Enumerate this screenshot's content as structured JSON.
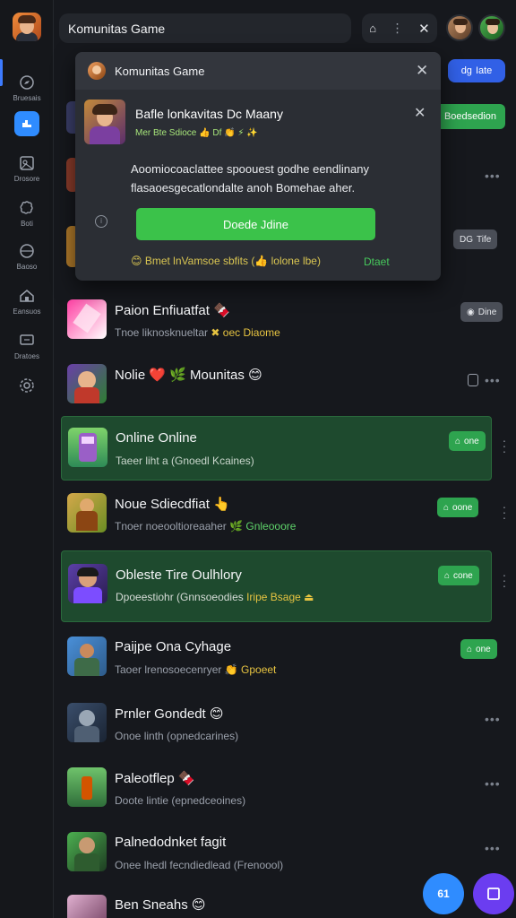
{
  "app": {
    "title": "Komunitas Game"
  },
  "sidebar": {
    "items": [
      {
        "label": "Bruesais",
        "icon": "compass-icon"
      },
      {
        "label": "Drosore",
        "icon": "gamepad-icon"
      },
      {
        "label": "Boti",
        "icon": "puzzle-icon"
      },
      {
        "label": "Baoso",
        "icon": "globe-icon"
      },
      {
        "label": "Eansuos",
        "icon": "home-icon"
      },
      {
        "label": "Dratoes",
        "icon": "monitor-icon"
      }
    ]
  },
  "topbar": {
    "search_value": "Komunitas Game",
    "home_icon": "home-icon",
    "more_icon": "more-vertical-icon",
    "close_icon": "close-icon"
  },
  "header_buttons": {
    "blue_label": "Iate",
    "blue_icon": "dg",
    "green_label": "Boedsedion"
  },
  "popup": {
    "title": "Komunitas Game",
    "card_title": "Bafle lonkavitas Dc Maany",
    "card_meta": "Mer Bte Sdioce 👍 Df 👏 ⚡ ✨",
    "description": "Aoomiocoaclattee spoouest godhe eendlinany flasaoesgecatlondalte anoh Bomehae aher.",
    "button_label": "Doede Jdine",
    "footer_text": "😊 Bmet lnVamsoe sbfits (👍 lolone lbe)",
    "footer_link": "Dtaet"
  },
  "rows": [
    {
      "title": "Paion Enfiuatfat 🍫",
      "subtitle_a": "Tnoe liknosknueltar ",
      "subtitle_b": "✖ oec Diaome",
      "badge": "Dine",
      "badge_icon": "◉",
      "badge_style": "gray"
    },
    {
      "title": "Nolie ❤️ 🌿 Mounitas 😊",
      "subtitle_a": "",
      "subtitle_b": "",
      "badge": "",
      "badge_icon": "",
      "badge_style": "none"
    },
    {
      "title": "Online Online",
      "subtitle_a": "Taeer liht a (Gnoedl Kcaines)",
      "subtitle_b": "",
      "badge": "one",
      "badge_icon": "⌂",
      "badge_style": "green"
    },
    {
      "title": "Noue Sdiecdfiat 👆",
      "subtitle_a": "Tnoer noeooltioreaaher ",
      "subtitle_b": "🌿 Gnleooore",
      "badge": "oone",
      "badge_icon": "⌂",
      "badge_style": "green"
    },
    {
      "title": "Obleste Tire Oulhlory",
      "subtitle_a": "Dpoeestiohr (Gnnsoeodies ",
      "subtitle_b": "Iripe Bsage ⏏",
      "badge": "cone",
      "badge_icon": "⌂",
      "badge_style": "green"
    },
    {
      "title": "Paijpe Ona Cyhage",
      "subtitle_a": "Taoer lrenosoecenryer ",
      "subtitle_b": "👏 Gpoeet",
      "badge": "one",
      "badge_icon": "⌂",
      "badge_style": "green"
    },
    {
      "title": "Prnler Gondedt 😊",
      "subtitle_a": "Onoe linth (opnedcarines)",
      "subtitle_b": "",
      "badge": "",
      "badge_icon": "",
      "badge_style": "none"
    },
    {
      "title": "Paleotflep 🍫",
      "subtitle_a": "Doote lintie (epnedceoines)",
      "subtitle_b": "",
      "badge": "",
      "badge_icon": "",
      "badge_style": "none"
    },
    {
      "title": "Palnedodnket fagit",
      "subtitle_a": "Onee lhedl fecndiedlead (Frenoool)",
      "subtitle_b": "",
      "badge": "",
      "badge_icon": "",
      "badge_style": "none"
    },
    {
      "title": "Ben Sneahs 😊",
      "subtitle_a": "",
      "subtitle_b": "",
      "badge": "",
      "badge_icon": "",
      "badge_style": "none"
    }
  ],
  "partial_rows": {
    "row2_badge": "Tife",
    "row2_badge_icon": "DG"
  },
  "fabs": {
    "left_label": "61",
    "left_color": "#2f8cff",
    "right_color": "#6b3df0"
  },
  "colors": {
    "accent_green": "#2ea44f",
    "accent_blue": "#3160e6",
    "background": "#16181d"
  }
}
